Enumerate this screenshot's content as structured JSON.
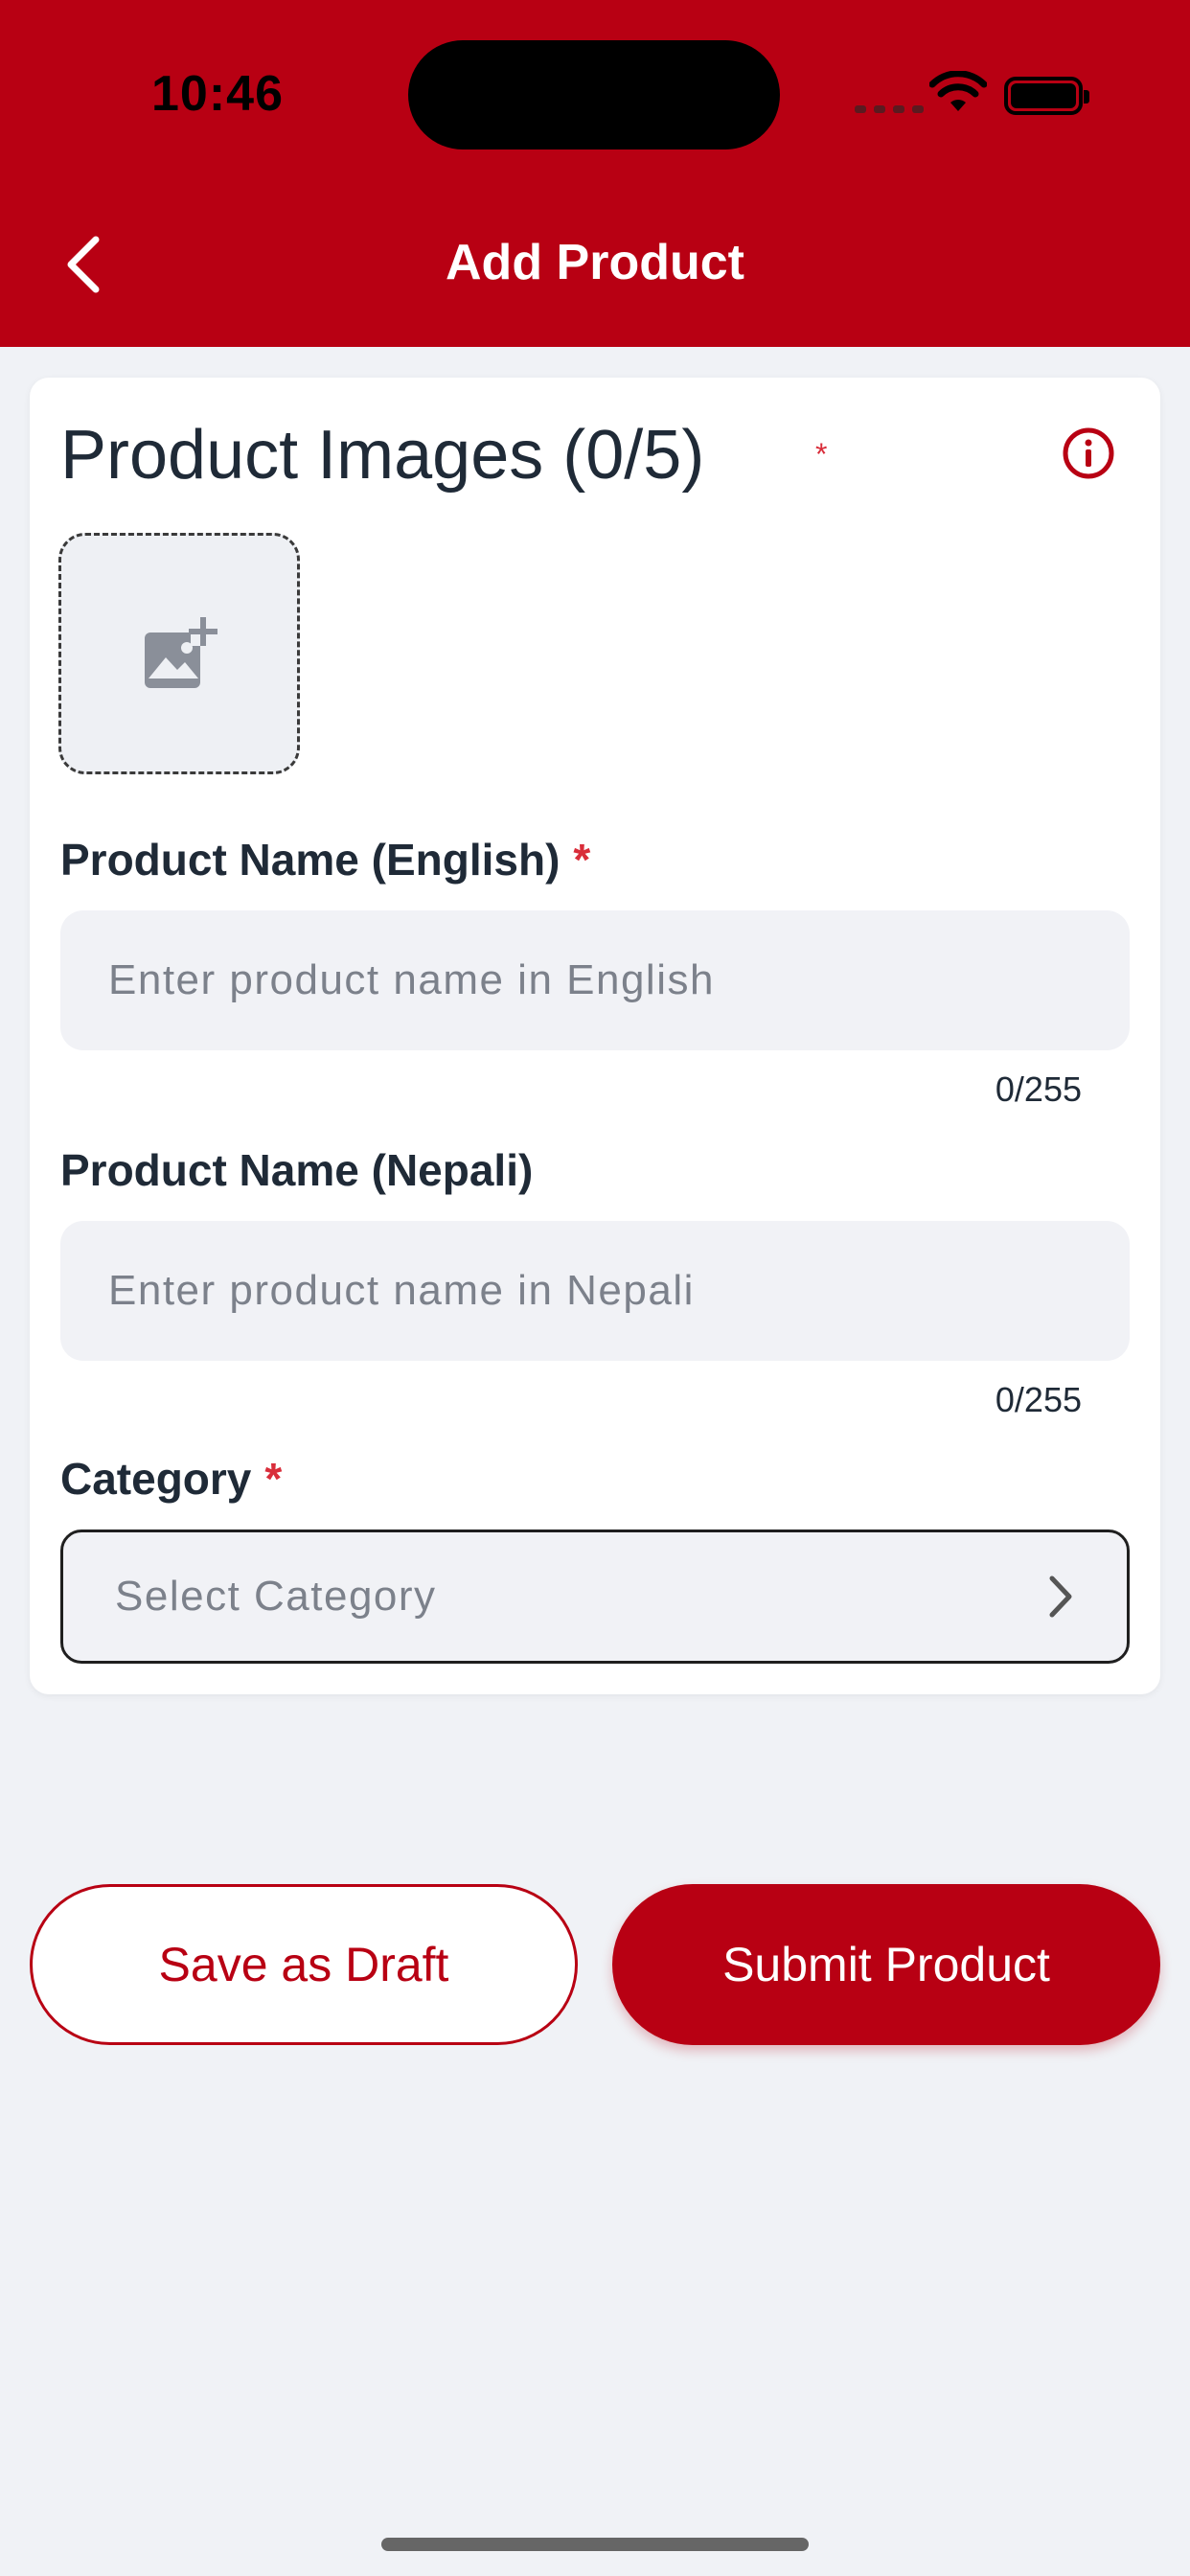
{
  "status_bar": {
    "time": "10:46"
  },
  "header": {
    "title": "Add Product",
    "back_icon": "chevron-left-icon"
  },
  "images_section": {
    "title": "Product Images (0/5)",
    "required_mark": "*",
    "info_icon": "info-circle-icon",
    "picker_icon": "add-image-icon"
  },
  "fields": {
    "name_en": {
      "label": "Product Name (English)",
      "required_mark": "*",
      "placeholder": "Enter product name in English",
      "value": "",
      "counter": "0/255"
    },
    "name_ne": {
      "label": "Product Name (Nepali)",
      "placeholder": "Enter product name in Nepali",
      "value": "",
      "counter": "0/255"
    },
    "category": {
      "label": "Category",
      "required_mark": "*",
      "placeholder": "Select Category",
      "chevron_icon": "chevron-right-icon"
    }
  },
  "actions": {
    "draft_label": "Save as Draft",
    "submit_label": "Submit Product"
  },
  "colors": {
    "brand": "#b80013",
    "required": "#d92d3a",
    "background": "#f0f2f6"
  }
}
